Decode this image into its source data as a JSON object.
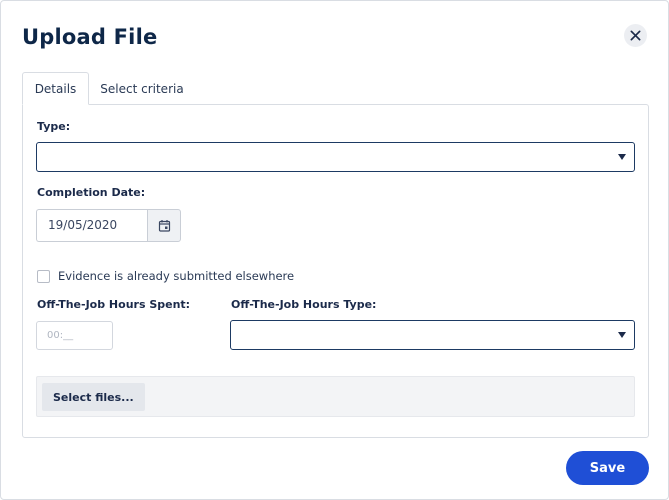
{
  "dialog": {
    "title": "Upload File",
    "close_icon": "close-icon"
  },
  "tabs": [
    {
      "label": "Details",
      "active": true
    },
    {
      "label": "Select criteria",
      "active": false
    }
  ],
  "form": {
    "type": {
      "label": "Type:",
      "value": ""
    },
    "completion_date": {
      "label": "Completion Date:",
      "value": "19/05/2020",
      "icon": "calendar-icon"
    },
    "evidence_checkbox": {
      "label": "Evidence is already submitted elsewhere",
      "checked": false
    },
    "hours_spent": {
      "label": "Off-The-Job Hours Spent:",
      "placeholder": "00:__"
    },
    "hours_type": {
      "label": "Off-The-Job Hours Type:",
      "value": ""
    },
    "select_files_label": "Select files..."
  },
  "footer": {
    "save_label": "Save"
  },
  "colors": {
    "primary": "#1f4fd6",
    "title": "#0e2748",
    "select_border": "#1d3a63"
  }
}
